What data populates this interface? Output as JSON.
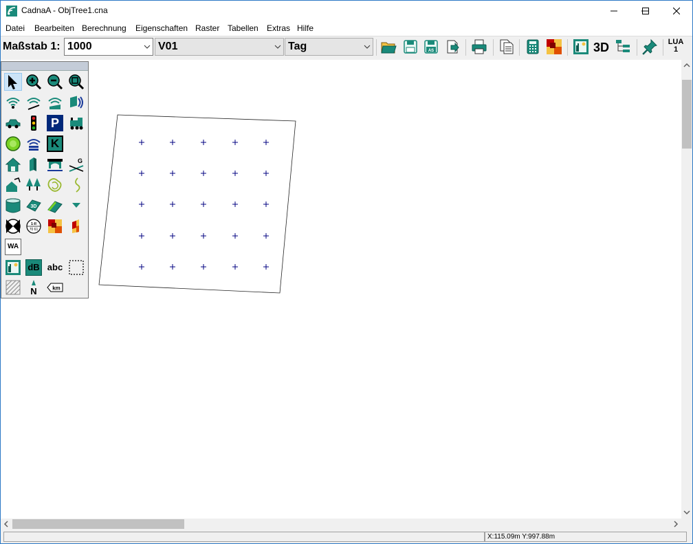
{
  "window": {
    "title": "CadnaA - ObjTree1.cna"
  },
  "menu": [
    "Datei",
    "Bearbeiten",
    "Berechnung",
    "Eigenschaften",
    "Raster",
    "Tabellen",
    "Extras",
    "Hilfe"
  ],
  "toolbar": {
    "scale_label": "Maßstab 1:",
    "scale_value": "1000",
    "variant_value": "V01",
    "period_value": "Tag",
    "three_d_label": "3D",
    "lua_label": "LUA",
    "lua_number": "1"
  },
  "palette": {
    "wa_label": "WA",
    "db_label": "dB",
    "abc_label": "abc",
    "km_label": "km",
    "north_label": "N",
    "three_d_label": "3D",
    "g_label": "G",
    "k_label": "K",
    "p_label": "P",
    "ratio_label": "1-II",
    "ratio_sub": "70 61"
  },
  "status": {
    "coords": "X:115.09m Y:997.88m"
  },
  "colors": {
    "accent": "#2b78c5",
    "grid_marker": "#000080",
    "toolbar_bg": "#f0f0f0"
  }
}
